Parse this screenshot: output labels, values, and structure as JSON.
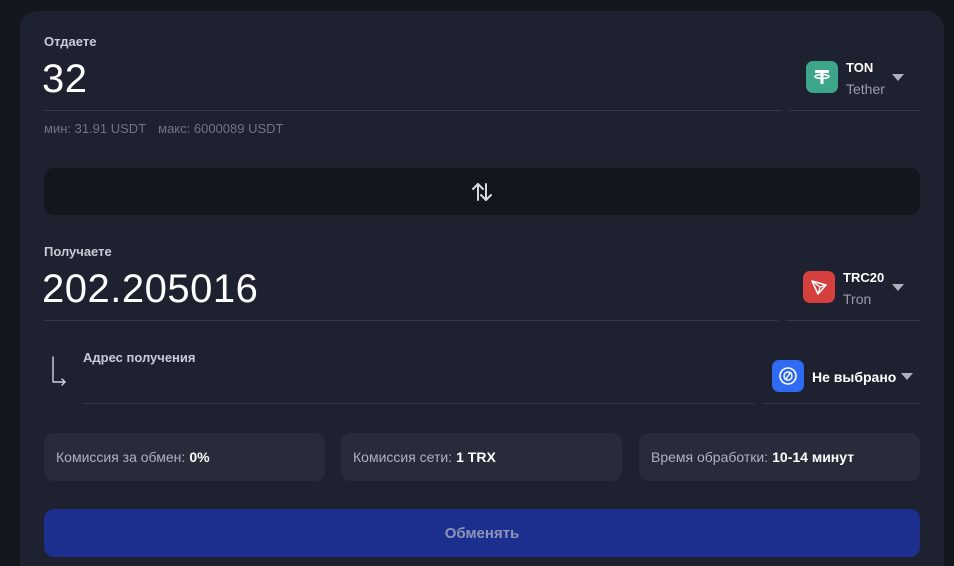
{
  "give": {
    "label": "Отдаете",
    "amount": "32",
    "min_text": "мин: 31.91 USDT",
    "max_text": "макс: 6000089 USDT",
    "coin": {
      "network": "TON",
      "name": "Tether",
      "icon": "tether-icon",
      "color": "#3da58a"
    }
  },
  "swap": {
    "icon": "swap-arrows-icon"
  },
  "receive": {
    "label": "Получаете",
    "amount": "202.205016",
    "coin": {
      "network": "TRC20",
      "name": "Tron",
      "icon": "tron-icon",
      "color": "#d5403e"
    }
  },
  "address": {
    "label": "Адрес получения",
    "value": "",
    "wallet": {
      "label": "Не выбрано",
      "icon": "wallet-icon",
      "color": "#2f6bf2"
    }
  },
  "info": {
    "fee_label": "Комиссия за обмен:",
    "fee_value": "0%",
    "network_fee_label": "Комиссия сети:",
    "network_fee_value": "1 TRX",
    "time_label": "Время обработки:",
    "time_value": "10-14 минут"
  },
  "exchange_button": {
    "label": "Обменять",
    "color": "#1c2f8e"
  }
}
